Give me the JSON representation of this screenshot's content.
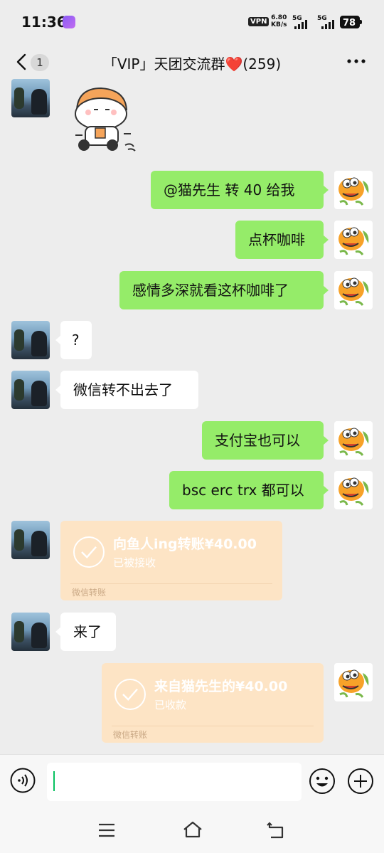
{
  "status_bar": {
    "time": "11:36",
    "vpn": "VPN",
    "net_speed_value": "6.80",
    "net_speed_unit": "KB/s",
    "sim1": "5G",
    "sim2": "5G",
    "battery": "78"
  },
  "header": {
    "unread_count": "1",
    "title": "「VIP」天团交流群❤️(259)"
  },
  "messages": [
    {
      "side": "friend",
      "type": "sticker"
    },
    {
      "side": "self",
      "type": "text",
      "text": "@猫先生  转 40 给我"
    },
    {
      "side": "self",
      "type": "text",
      "text": "点杯咖啡"
    },
    {
      "side": "self",
      "type": "text",
      "text": "感情多深就看这杯咖啡了"
    },
    {
      "side": "friend",
      "type": "text",
      "text": "?"
    },
    {
      "side": "friend",
      "type": "text",
      "text": "微信转不出去了"
    },
    {
      "side": "self",
      "type": "text",
      "text": "支付宝也可以"
    },
    {
      "side": "self",
      "type": "text",
      "text": "bsc erc trx 都可以"
    },
    {
      "side": "friend",
      "type": "transfer",
      "amount": "向鱼人ing转账¥40.00",
      "status": "已被接收",
      "footer": "微信转账"
    },
    {
      "side": "friend",
      "type": "text",
      "text": "来了"
    },
    {
      "side": "self",
      "type": "transfer",
      "amount": "来自猫先生的¥40.00",
      "status": "已收款",
      "footer": "微信转账"
    }
  ],
  "input_bar": {
    "message_value": "",
    "icons": [
      "voice-icon",
      "emoji-icon",
      "plus-icon"
    ]
  },
  "nav_bar": {
    "icons": [
      "menu-icon",
      "home-icon",
      "back-icon"
    ]
  },
  "colors": {
    "background": "#ededed",
    "self_bubble": "#95ec69",
    "friend_bubble": "#ffffff",
    "transfer_card": "#fde4c5",
    "cursor": "#07c160"
  }
}
